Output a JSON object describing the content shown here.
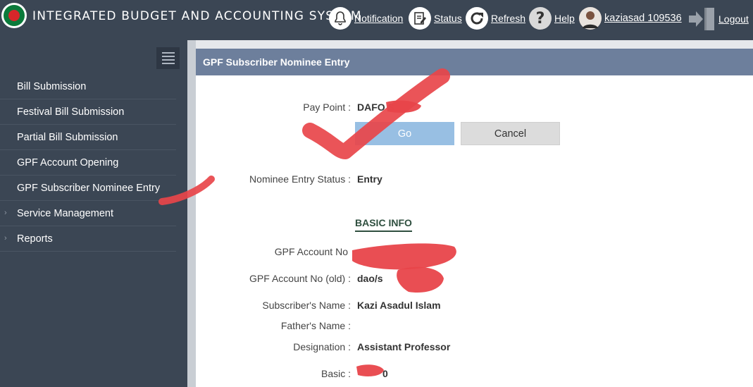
{
  "header": {
    "title": "INTEGRATED BUDGET AND ACCOUNTING SYSTEM",
    "notification_label": "Notification",
    "status_label": "Status",
    "refresh_label": "Refresh",
    "help_label": "Help",
    "user_label": "kaziasad 109536",
    "logout_label": "Logout"
  },
  "sidebar": {
    "items": [
      {
        "label": "Bill Submission"
      },
      {
        "label": "Festival Bill Submission"
      },
      {
        "label": "Partial Bill Submission"
      },
      {
        "label": "GPF Account Opening"
      },
      {
        "label": "GPF Subscriber Nominee Entry"
      },
      {
        "label": "Service Management"
      },
      {
        "label": "Reports"
      }
    ]
  },
  "panel": {
    "title": "GPF Subscriber Nominee Entry",
    "pay_point_label": "Pay Point :",
    "pay_point_value": "DAFO S",
    "go_label": "Go",
    "cancel_label": "Cancel",
    "nominee_status_label": "Nominee Entry Status :",
    "nominee_status_value": "Entry",
    "basic_info_heading": "BASIC INFO",
    "gpf_no_label": "GPF Account No",
    "gpf_old_label": "GPF Account No (old) :",
    "gpf_old_value": "dao/s",
    "subscriber_label": "Subscriber's Name :",
    "subscriber_value": "Kazi Asadul Islam",
    "father_label": "Father's Name :",
    "father_value": "",
    "designation_label": "Designation :",
    "designation_value": "Assistant Professor",
    "basic_label": "Basic :",
    "basic_value": "0"
  },
  "colors": {
    "header_bg": "#3b4654",
    "panel_header_bg": "#6d7f9c",
    "go_button_bg": "#98bfe3",
    "annotation_red": "#e8454a"
  }
}
